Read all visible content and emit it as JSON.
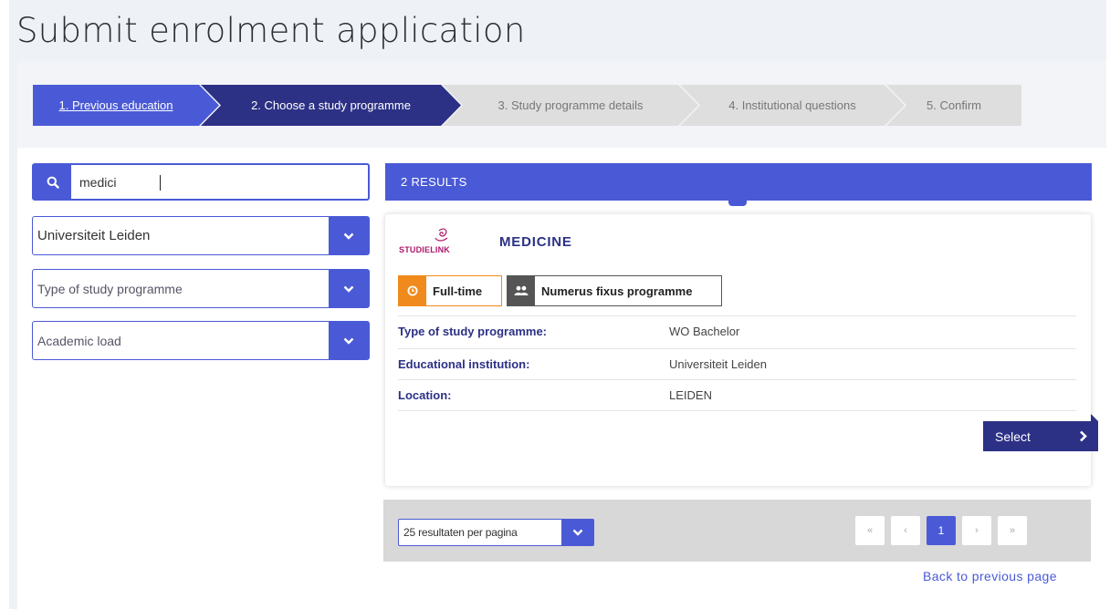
{
  "page": {
    "title": "Submit enrolment application"
  },
  "steps": [
    {
      "label": "1. Previous education"
    },
    {
      "label": "2. Choose a study programme"
    },
    {
      "label": "3. Study programme details"
    },
    {
      "label": "4. Institutional questions"
    },
    {
      "label": "5. Confirm"
    }
  ],
  "filters": {
    "search": {
      "value": "medici",
      "placeholder": ""
    },
    "institution": {
      "selected": "Universiteit Leiden"
    },
    "type": {
      "placeholder": "Type of study programme"
    },
    "load": {
      "placeholder": "Academic load"
    }
  },
  "results": {
    "header": "2 RESULTS",
    "item": {
      "logo_text": "STUDIELINK",
      "name": "MEDICINE",
      "badges": {
        "fulltime": "Full-time",
        "numerus": "Numerus fixus programme"
      },
      "details": [
        {
          "key": "Type of study programme:",
          "value": "WO Bachelor"
        },
        {
          "key": "Educational institution:",
          "value": "Universiteit Leiden"
        },
        {
          "key": "Location:",
          "value": "LEIDEN"
        }
      ],
      "select_label": "Select"
    }
  },
  "pagination": {
    "per_page": "25 resultaten per pagina",
    "first": "«",
    "prev": "‹",
    "current": "1",
    "next": "›",
    "last": "»"
  },
  "back_link": "Back to previous page",
  "colors": {
    "accent": "#4a5ad6",
    "dark": "#2c3185",
    "orange": "#f08a1c",
    "grey": "#555555"
  }
}
